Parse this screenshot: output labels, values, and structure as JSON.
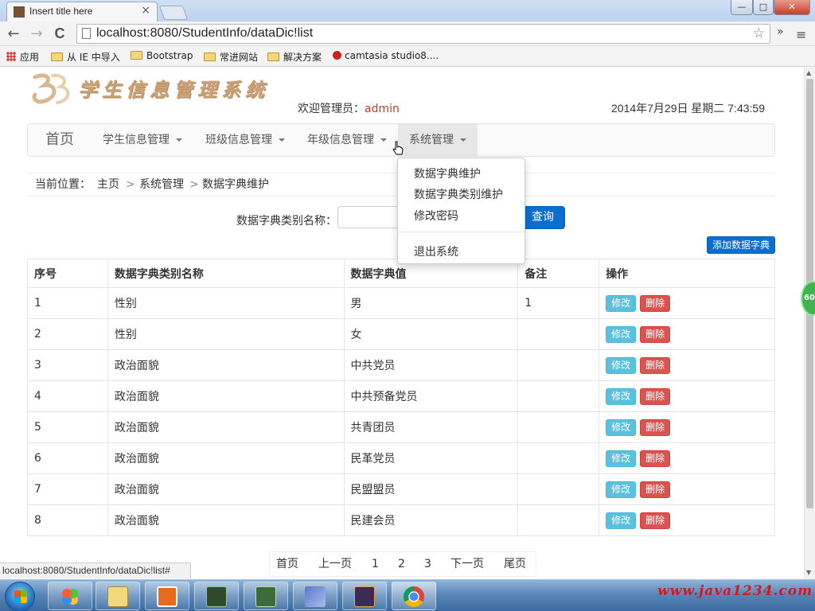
{
  "browser": {
    "tab_title": "Insert title here",
    "tab_close": "×",
    "back": "←",
    "forward": "→",
    "reload": "C",
    "url": "localhost:8080/StudentInfo/dataDic!list",
    "star": "☆",
    "overflow": "»",
    "menu": "≡",
    "window_min": "—",
    "window_max": "□",
    "window_close": "✕",
    "bookmarks": [
      "应用",
      "从 IE 中导入",
      "Bootstrap",
      "常进网站",
      "解决方案",
      "camtasia studio8...."
    ]
  },
  "header": {
    "welcome_prefix": "欢迎管理员：",
    "username": "admin",
    "datetime": "2014年7月29日 星期二 7:43:59",
    "logo_text": "学生信息管理系统"
  },
  "nav": {
    "brand": "首页",
    "items": [
      "学生信息管理",
      "班级信息管理",
      "年级信息管理",
      "系统管理"
    ]
  },
  "dropdown": {
    "items": [
      "数据字典维护",
      "数据字典类别维护",
      "修改密码",
      "退出系统"
    ]
  },
  "breadcrumb": {
    "label": "当前位置：",
    "path": [
      "主页",
      "系统管理",
      "数据字典维护"
    ],
    "separator": ">"
  },
  "search": {
    "label": "数据字典类别名称：",
    "value": "",
    "button": "查询"
  },
  "add_button": "添加数据字典",
  "table": {
    "headers": [
      "序号",
      "数据字典类别名称",
      "数据字典值",
      "备注",
      "操作"
    ],
    "rows": [
      {
        "id": "1",
        "category": "性别",
        "value": "男",
        "remark": "1"
      },
      {
        "id": "2",
        "category": "性别",
        "value": "女",
        "remark": ""
      },
      {
        "id": "3",
        "category": "政治面貌",
        "value": "中共党员",
        "remark": ""
      },
      {
        "id": "4",
        "category": "政治面貌",
        "value": "中共预备党员",
        "remark": ""
      },
      {
        "id": "5",
        "category": "政治面貌",
        "value": "共青团员",
        "remark": ""
      },
      {
        "id": "6",
        "category": "政治面貌",
        "value": "民革党员",
        "remark": ""
      },
      {
        "id": "7",
        "category": "政治面貌",
        "value": "民盟盟员",
        "remark": ""
      },
      {
        "id": "8",
        "category": "政治面貌",
        "value": "民建会员",
        "remark": ""
      }
    ],
    "edit_label": "修改",
    "delete_label": "删除"
  },
  "pagination": [
    "首页",
    "上一页",
    "1",
    "2",
    "3",
    "下一页",
    "尾页"
  ],
  "status_url": "localhost:8080/StudentInfo/dataDic!list#",
  "side_badge": "60",
  "watermark": "www.java1234.com",
  "colors": {
    "primary": "#0c6ed0",
    "edit": "#5bc0de",
    "delete": "#d9534f",
    "username": "#c0392b"
  }
}
